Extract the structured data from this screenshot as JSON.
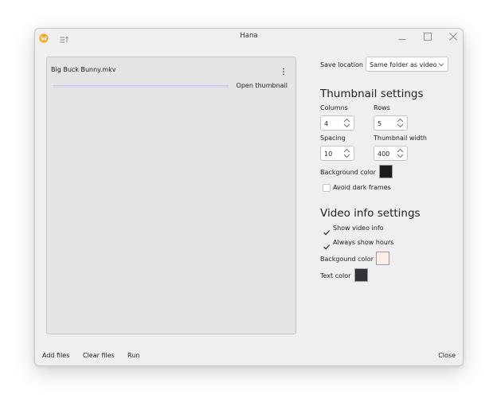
{
  "window": {
    "title": "Hana"
  },
  "file_list": {
    "items": [
      {
        "name": "Big Buck Bunny.mkv",
        "action_label": "Open thumbnail"
      }
    ]
  },
  "settings": {
    "save_location_label": "Save location",
    "save_location_value": "Same folder as video",
    "thumbnail": {
      "heading": "Thumbnail settings",
      "columns_label": "Columns",
      "columns_value": "4",
      "rows_label": "Rows",
      "rows_value": "5",
      "spacing_label": "Spacing",
      "spacing_value": "10",
      "width_label": "Thumbnail width",
      "width_value": "400",
      "background_color_label": "Background color",
      "background_color": "#1b1c1e",
      "avoid_dark_frames_label": "Avoid dark frames",
      "avoid_dark_frames_checked": false
    },
    "video_info": {
      "heading": "Video info settings",
      "show_video_info_label": "Show video info",
      "show_video_info_checked": true,
      "always_show_hours_label": "Always show hours",
      "always_show_hours_checked": true,
      "background_color_label": "Backgound color",
      "background_color": "#fbeee6",
      "text_color_label": "Text color",
      "text_color": "#2f3338"
    }
  },
  "footer": {
    "add_files_label": "Add files",
    "clear_files_label": "Clear files",
    "run_label": "Run",
    "close_label": "Close"
  },
  "icons": {
    "app": "hana-logo-icon",
    "menu": "sort-menu-icon",
    "kebab": "more-vertical-icon"
  },
  "colors": {
    "accent": "#f5a623",
    "window_bg": "#efeff1",
    "panel_bg": "#e4e4e7"
  }
}
